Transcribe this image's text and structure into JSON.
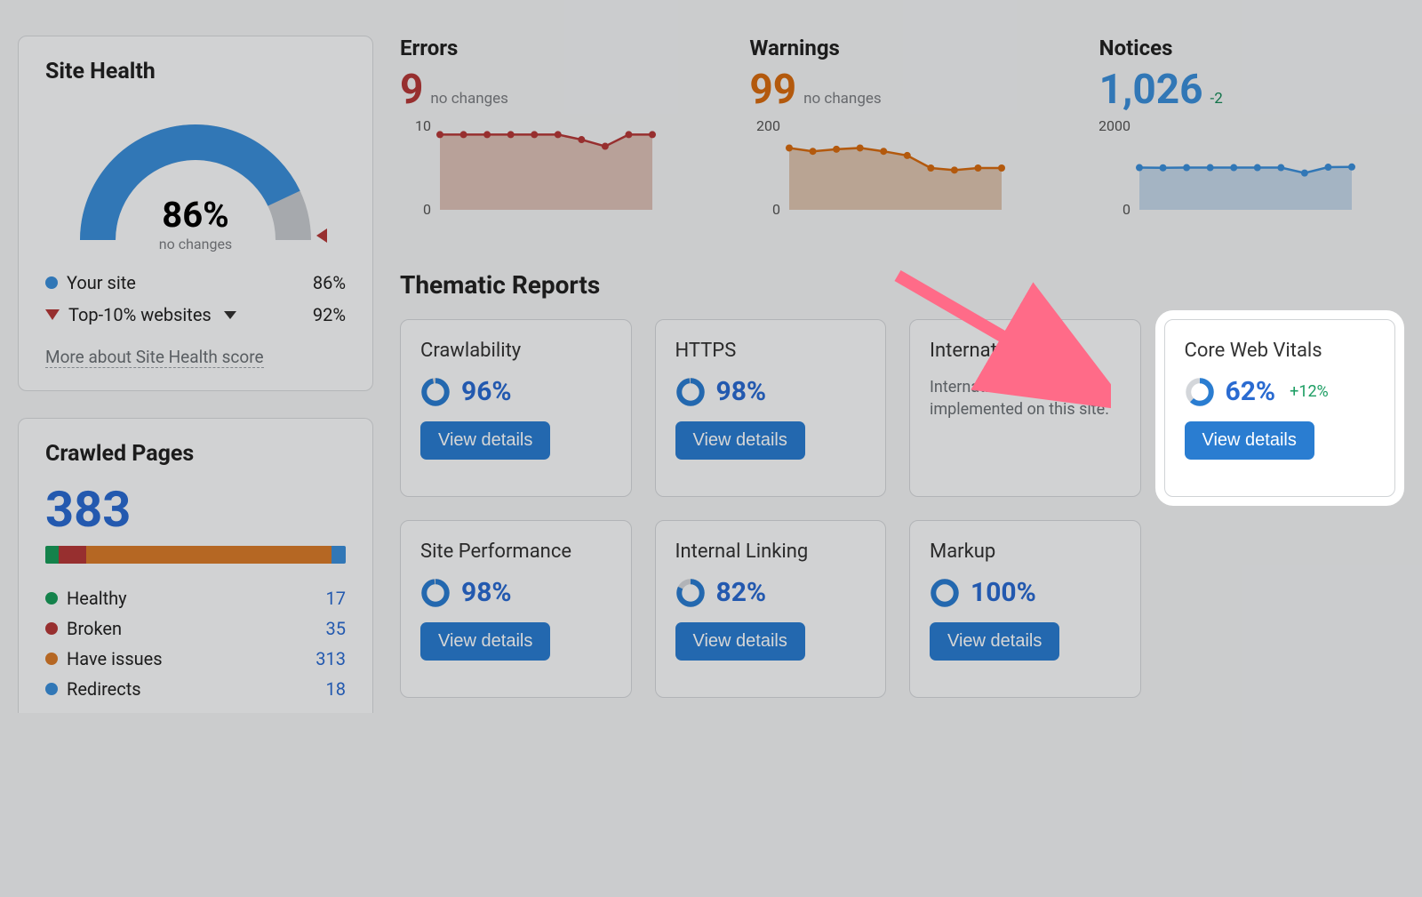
{
  "colors": {
    "blue": "#2a6bd1",
    "btn": "#2a7dd1",
    "red": "#b43838",
    "orange": "#d87b2a",
    "darkorange": "#d66b10",
    "green": "#1e9e64",
    "lightblue": "#bcd3e8",
    "grey": "#c7cbd0",
    "dgrey": "#9aa0a5",
    "redfill": "#d8b6ac",
    "orangefill": "#d9bba3",
    "bluefill": "#bcd1e6",
    "seg_green": "#189b5a",
    "seg_red": "#b43838",
    "seg_orange": "#d87b2a",
    "seg_blue": "#3b8ed9"
  },
  "site_health": {
    "title": "Site Health",
    "value": 86,
    "display": "86%",
    "sub": "no changes",
    "legend": [
      {
        "kind": "dot",
        "color": "#3b8ed9",
        "label": "Your site",
        "value": "86%"
      },
      {
        "kind": "tri",
        "label": "Top-10% websites",
        "expandable": true,
        "value": "92%"
      }
    ],
    "more_link": "More about Site Health score"
  },
  "crawled_pages": {
    "title": "Crawled Pages",
    "total": "383",
    "segments": [
      {
        "label": "Healthy",
        "value": 17,
        "color": "#189b5a"
      },
      {
        "label": "Broken",
        "value": 35,
        "color": "#b43838"
      },
      {
        "label": "Have issues",
        "value": 313,
        "color": "#d87b2a"
      },
      {
        "label": "Redirects",
        "value": 18,
        "color": "#3b8ed9"
      }
    ]
  },
  "chart_data": [
    {
      "type": "area",
      "title": "Errors",
      "value_display": "9",
      "value": 9,
      "sub": "no changes",
      "color": "#b43838",
      "fill": "#d8b6ac",
      "ylim": [
        0,
        10
      ],
      "yticks": [
        0,
        10
      ],
      "values": [
        9,
        9,
        9,
        9,
        9,
        9,
        8.4,
        7.6,
        9,
        9
      ]
    },
    {
      "type": "area",
      "title": "Warnings",
      "value_display": "99",
      "value": 99,
      "sub": "no changes",
      "color": "#d66b10",
      "fill": "#d9bba3",
      "ylim": [
        0,
        200
      ],
      "yticks": [
        0,
        200
      ],
      "values": [
        148,
        140,
        145,
        148,
        140,
        130,
        100,
        95,
        100,
        100
      ]
    },
    {
      "type": "area",
      "title": "Notices",
      "value_display": "1,026",
      "value": 1026,
      "delta": "-2",
      "color": "#3b8ed9",
      "fill": "#bcd1e6",
      "ylim": [
        0,
        2000
      ],
      "yticks": [
        0,
        2000
      ],
      "values": [
        1010,
        1005,
        1010,
        1010,
        1010,
        1010,
        1010,
        880,
        1020,
        1026
      ]
    }
  ],
  "thematic": {
    "title": "Thematic Reports",
    "reports": [
      {
        "title": "Crawlability",
        "pct": "96%",
        "pct_val": 96,
        "button": "View details"
      },
      {
        "title": "HTTPS",
        "pct": "98%",
        "pct_val": 98,
        "button": "View details"
      },
      {
        "title": "International SEO",
        "desc": "International SEO is not implemented on this site."
      },
      {
        "title": "Core Web Vitals",
        "pct": "62%",
        "pct_val": 62,
        "delta": "+12%",
        "button": "View details",
        "highlight": true
      },
      {
        "title": "Site Performance",
        "pct": "98%",
        "pct_val": 98,
        "button": "View details"
      },
      {
        "title": "Internal Linking",
        "pct": "82%",
        "pct_val": 82,
        "button": "View details"
      },
      {
        "title": "Markup",
        "pct": "100%",
        "pct_val": 100,
        "button": "View details"
      }
    ]
  }
}
